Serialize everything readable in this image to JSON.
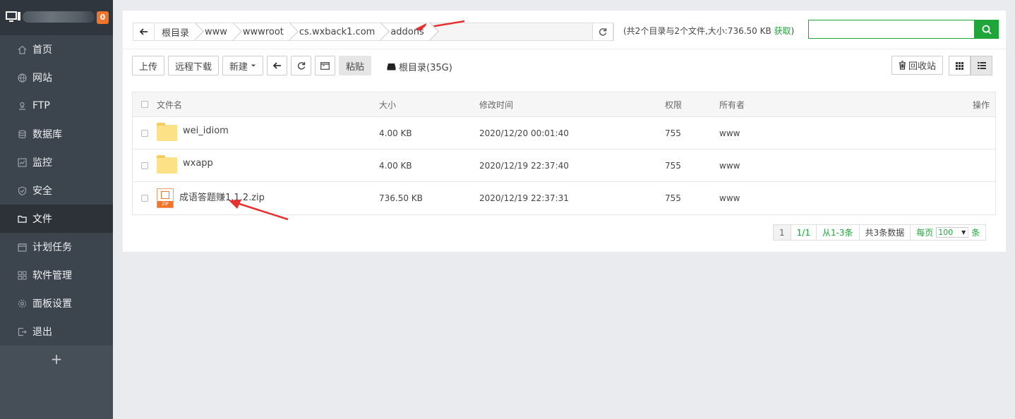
{
  "sidebar": {
    "badge": "0",
    "items": [
      {
        "label": "首页",
        "icon": "home-icon"
      },
      {
        "label": "网站",
        "icon": "globe-icon"
      },
      {
        "label": "FTP",
        "icon": "ftp-icon"
      },
      {
        "label": "数据库",
        "icon": "database-icon"
      },
      {
        "label": "监控",
        "icon": "monitor-icon"
      },
      {
        "label": "安全",
        "icon": "shield-icon"
      },
      {
        "label": "文件",
        "icon": "folder-icon"
      },
      {
        "label": "计划任务",
        "icon": "calendar-icon"
      },
      {
        "label": "软件管理",
        "icon": "apps-icon"
      },
      {
        "label": "面板设置",
        "icon": "gear-icon"
      },
      {
        "label": "退出",
        "icon": "logout-icon"
      }
    ],
    "add_label": "+"
  },
  "path": {
    "crumbs": [
      "根目录",
      "www",
      "wwwroot",
      "cs.wxback1.com",
      "addons"
    ]
  },
  "summary": {
    "text": "(共2个目录与2个文件,大小:736.50 KB ",
    "link": "获取",
    "close": ")"
  },
  "search": {
    "placeholder": ""
  },
  "toolbar": {
    "upload": "上传",
    "remote_download": "远程下载",
    "new": "新建",
    "paste": "粘贴",
    "disk": "根目录(35G)",
    "recycle": "回收站"
  },
  "table": {
    "headers": {
      "name": "文件名",
      "size": "大小",
      "time": "修改时间",
      "perm": "权限",
      "owner": "所有者",
      "op": "操作"
    },
    "rows": [
      {
        "type": "folder",
        "name": "wei_idiom",
        "size": "4.00 KB",
        "time": "2020/12/20 00:01:40",
        "perm": "755",
        "owner": "www"
      },
      {
        "type": "folder",
        "name": "wxapp",
        "size": "4.00 KB",
        "time": "2020/12/19 22:37:40",
        "perm": "755",
        "owner": "www"
      },
      {
        "type": "zip",
        "name": "成语答题赚1.1.2.zip",
        "size": "736.50 KB",
        "time": "2020/12/19 22:37:31",
        "perm": "755",
        "owner": "www"
      }
    ]
  },
  "pager": {
    "current": "1",
    "pages": "1/1",
    "range": "从1-3条",
    "total": "共3条数据",
    "per_page_label": "每页",
    "per_page": "100",
    "unit": "条"
  },
  "colors": {
    "accent": "#20a53a",
    "badge": "#f0752b",
    "sidebar": "#3c444d",
    "annotation": "#e8302f"
  }
}
